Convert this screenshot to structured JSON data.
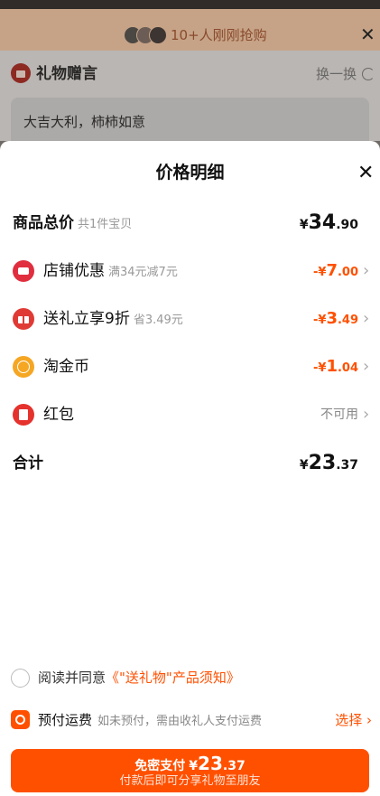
{
  "background": {
    "banner_text": "10+人刚刚抢购",
    "gift_section_title": "礼物赠言",
    "swap_label": "换一换",
    "message_text": "大吉大利，柿柿如意"
  },
  "sheet": {
    "title": "价格明细",
    "rows": {
      "goods_total": {
        "label": "商品总价",
        "sub": "共1件宝贝",
        "yuan": "¥",
        "big": "34",
        "small": ".90"
      },
      "shop_discount": {
        "label": "店铺优惠",
        "sub": "满34元减7元",
        "prefix": "-¥",
        "big": "7",
        "small": ".00"
      },
      "gift_discount": {
        "label": "送礼立享9折",
        "sub": "省3.49元",
        "prefix": "-¥",
        "big": "3",
        "small": ".49"
      },
      "coins": {
        "label": "淘金币",
        "prefix": "-¥",
        "big": "1",
        "small": ".04"
      },
      "red_packet": {
        "label": "红包",
        "status": "不可用"
      },
      "total": {
        "label": "合计",
        "yuan": "¥",
        "big": "23",
        "small": ".37"
      }
    },
    "chevron": "›"
  },
  "agreement": {
    "text": "阅读并同意",
    "link": "《\"送礼物\"产品须知》"
  },
  "freight": {
    "title": "预付运费",
    "desc": "如未预付，需由收礼人支付运费",
    "select_label": "选择 ›"
  },
  "pay_button": {
    "label": "免密支付",
    "yuan": "¥",
    "big": "23",
    "small": ".37",
    "subtitle": "付款后即可分享礼物至朋友"
  },
  "colors": {
    "accent": "#ff5000",
    "overlay": "#6f6a66"
  },
  "icons": {
    "close": "close-icon",
    "shop": "shop-icon",
    "gift": "gift-icon",
    "coin": "coin-icon",
    "red_packet": "red-packet-icon"
  }
}
